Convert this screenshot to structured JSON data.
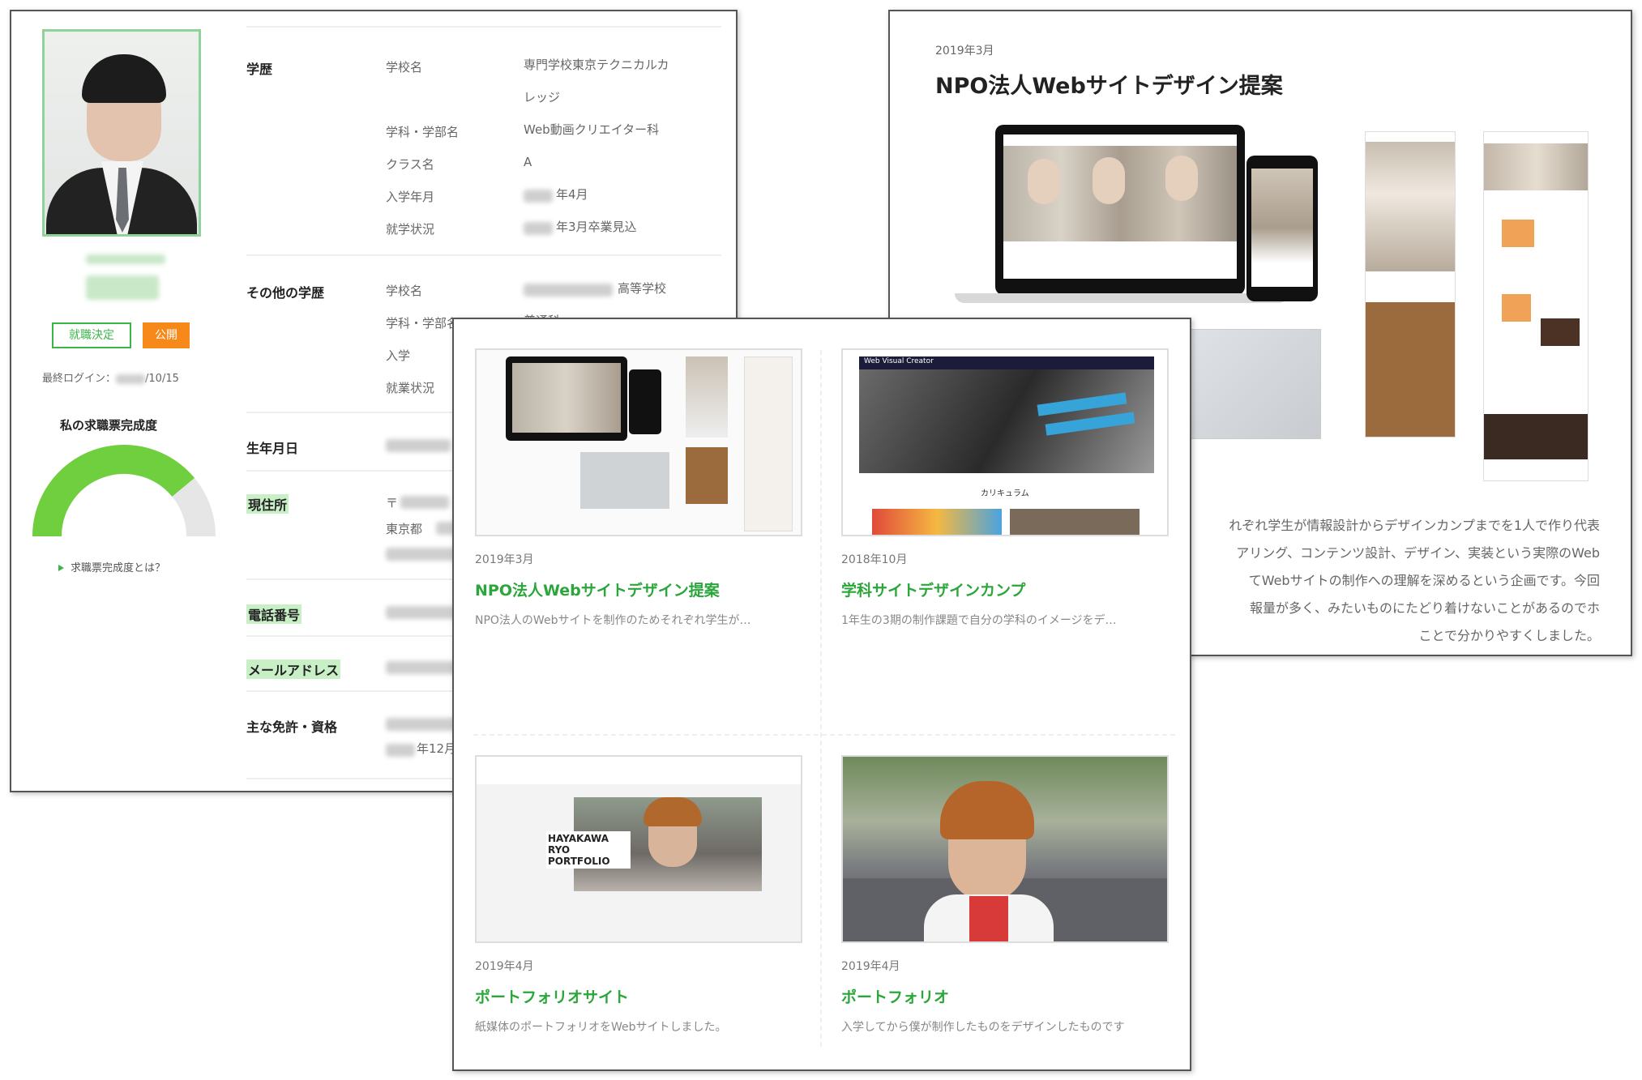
{
  "profile": {
    "buttons": {
      "employment_decided": "就職決定",
      "public": "公開"
    },
    "last_login_label": "最終ログイン：",
    "last_login_value": "/10/15",
    "gauge": {
      "title": "私の求職票完成度",
      "link": "求職票完成度とは？",
      "fill_fraction": 0.78,
      "fill_color": "#6fcf3f",
      "track_color": "#e6e6e6"
    },
    "sections": {
      "education": {
        "label": "学歴",
        "fields": [
          {
            "label": "学校名",
            "value": "専門学校東京テクニカルカ",
            "value2": "レッジ"
          },
          {
            "label": "学科・学部名",
            "value": "Web動画クリエイター科"
          },
          {
            "label": "クラス名",
            "value": "A"
          },
          {
            "label": "入学年月",
            "value": "年4月"
          },
          {
            "label": "就学状況",
            "value": "年3月卒業見込"
          }
        ]
      },
      "other_education": {
        "label": "その他の学歴",
        "fields": [
          {
            "label": "学校名",
            "value": "高等学校"
          },
          {
            "label": "学科・学部名",
            "value": "普通科"
          },
          {
            "label": "入学",
            "value": ""
          },
          {
            "label": "就業状況",
            "value": ""
          }
        ]
      },
      "birthday": {
        "label": "生年月日"
      },
      "address": {
        "label": "現住所",
        "postal_prefix": "〒",
        "city": "東京都"
      },
      "phone": {
        "label": "電話番号"
      },
      "email": {
        "label": "メールアドレス"
      },
      "licenses": {
        "label": "主な免許・資格",
        "value": "年12月"
      }
    }
  },
  "project_detail": {
    "date": "2019年3月",
    "title": "NPO法人Webサイトデザイン提案",
    "body_lines": [
      "れぞれ学生が情報設計からデザインカンプまでを1人で作り代表",
      "アリング、コンテンツ設計、デザイン、実装という実際のWeb",
      "てWebサイトの制作への理解を深めるという企画です。今回",
      "報量が多く、みたいものにたどり着けないことがあるのでホ",
      "ことで分かりやすくしました。"
    ]
  },
  "portfolio": {
    "cards": [
      {
        "date": "2019年3月",
        "title": "NPO法人Webサイトデザイン提案",
        "desc": "NPO法人のWebサイトを制作のためそれぞれ学生が…"
      },
      {
        "date": "2018年10月",
        "title": "学科サイトデザインカンプ",
        "desc": "1年生の3期の制作課題で自分の学科のイメージをデ…",
        "thumb_header": "Web Visual Creator",
        "thumb_caption": "カリキュラム"
      },
      {
        "date": "2019年4月",
        "title": "ポートフォリオサイト",
        "desc": "紙媒体のポートフォリオをWebサイトしました。",
        "thumb_text": "HAYAKAWA RYO PORTFOLIO"
      },
      {
        "date": "2019年4月",
        "title": "ポートフォリオ",
        "desc": "入学してから僕が制作したものをデザインしたものです"
      }
    ]
  }
}
